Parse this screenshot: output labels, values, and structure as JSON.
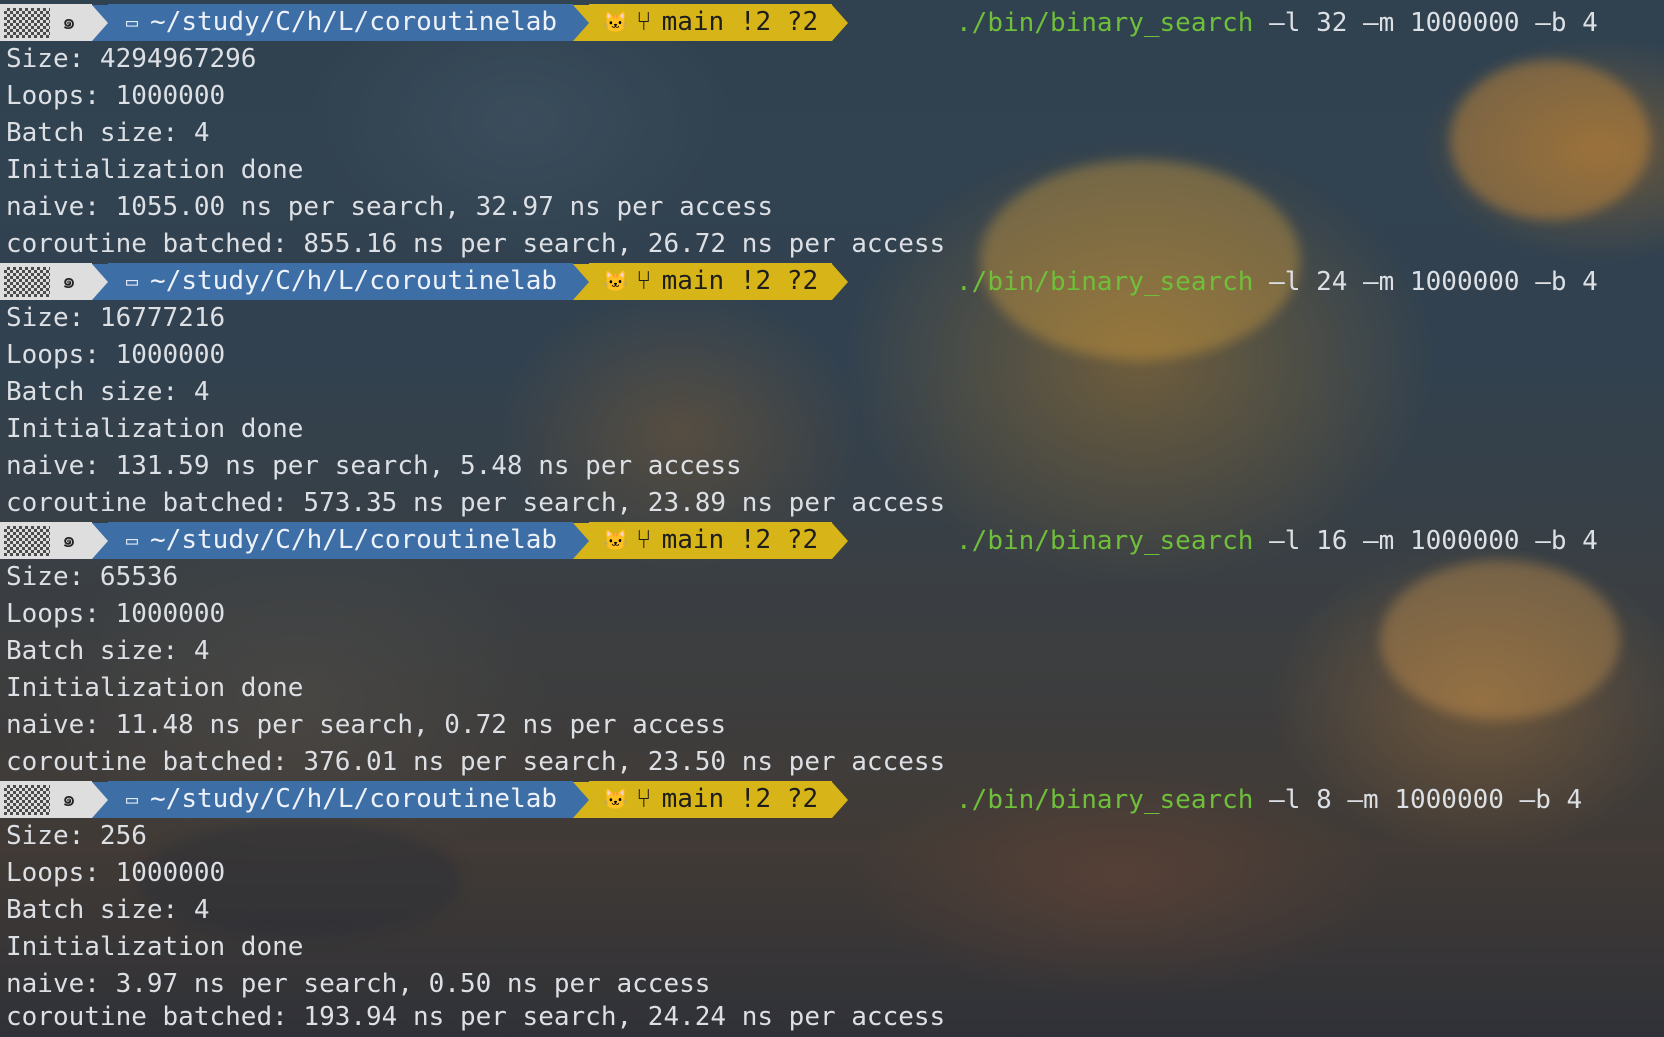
{
  "prompt": {
    "os_icon": "spiral-icon",
    "folder_icon": "folder-icon",
    "path": "~/study/C/h/L/coroutinelab",
    "git_icon": "cat-icon",
    "branch_icon": "branch-icon",
    "git_status": "main !2 ?2",
    "command": "./bin/binary_search",
    "colors": {
      "os_bg": "#dedede",
      "dir_bg": "#3d6ea6",
      "git_bg": "#d7b417",
      "command_color": "#6fbf3a"
    }
  },
  "runs": [
    {
      "args": " –l 32 –m 1000000 –b 4",
      "output": [
        "Size: 4294967296",
        "Loops: 1000000",
        "Batch size: 4",
        "Initialization done",
        "naive: 1055.00 ns per search, 32.97 ns per access",
        "coroutine batched: 855.16 ns per search, 26.72 ns per access"
      ]
    },
    {
      "args": " –l 24 –m 1000000 –b 4",
      "output": [
        "Size: 16777216",
        "Loops: 1000000",
        "Batch size: 4",
        "Initialization done",
        "naive: 131.59 ns per search, 5.48 ns per access",
        "coroutine batched: 573.35 ns per search, 23.89 ns per access"
      ]
    },
    {
      "args": " –l 16 –m 1000000 –b 4",
      "output": [
        "Size: 65536",
        "Loops: 1000000",
        "Batch size: 4",
        "Initialization done",
        "naive: 11.48 ns per search, 0.72 ns per access",
        "coroutine batched: 376.01 ns per search, 23.50 ns per access"
      ]
    },
    {
      "args": " –l 8 –m 1000000 –b 4",
      "output": [
        "Size: 256",
        "Loops: 1000000",
        "Batch size: 4",
        "Initialization done",
        "naive: 3.97 ns per search, 0.50 ns per access",
        "coroutine batched: 193.94 ns per search, 24.24 ns per access"
      ]
    }
  ]
}
